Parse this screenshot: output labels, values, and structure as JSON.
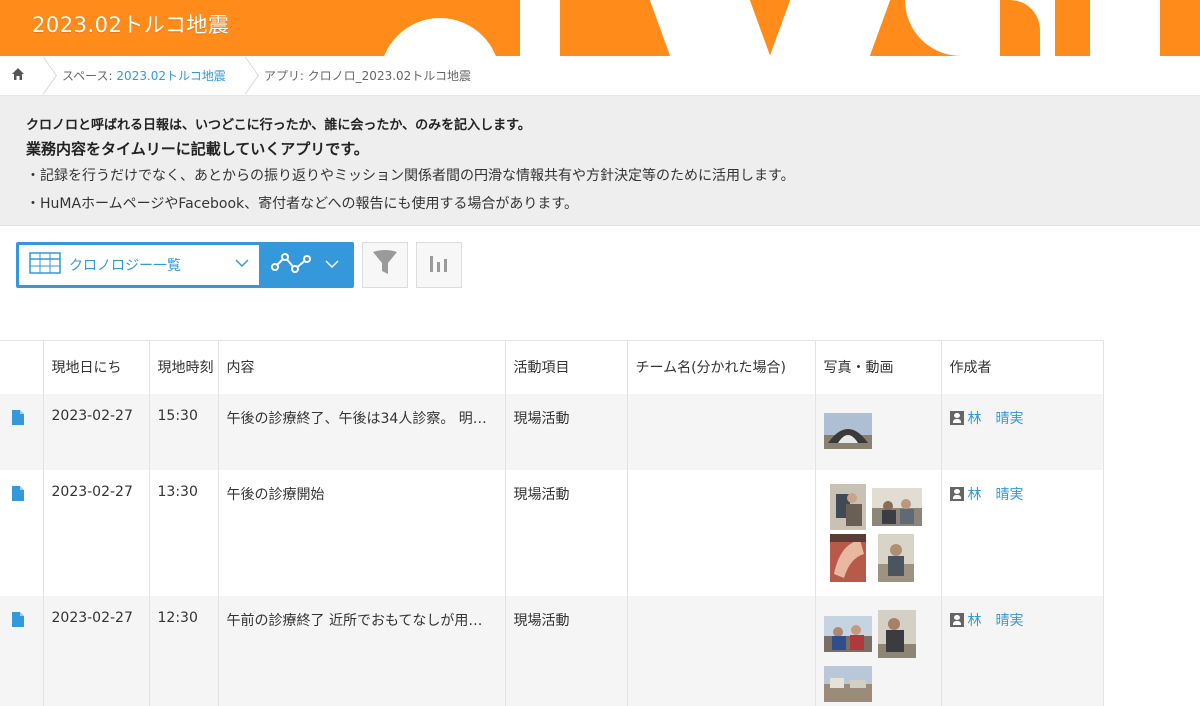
{
  "space_title": "2023.02トルコ地震",
  "colors": {
    "brand_orange": "#ff8c1a",
    "accent_blue": "#3498db"
  },
  "breadcrumb": {
    "home_icon": "home-icon",
    "space_prefix": "スペース: ",
    "space_name": "2023.02トルコ地震",
    "app": "アプリ: クロノロ_2023.02トルコ地震"
  },
  "description": {
    "line1": "クロノロと呼ばれる日報は、いつどこに行ったか、誰に会ったか、のみを記入します。",
    "line2": "業務内容をタイムリーに記載していくアプリです。",
    "line3": "・記録を行うだけでなく、あとからの振り返りやミッション関係者間の円滑な情報共有や方針決定等のために活用します。",
    "line4": "・HuMAホームページやFacebook、寄付者などへの報告にも使用する場合があります。"
  },
  "toolbar": {
    "view_name": "クロノロジー一覧",
    "view_icon": "table-view-icon",
    "graph_icon": "graph-icon",
    "filter_icon": "filter-icon",
    "chart_icon": "bar-chart-icon"
  },
  "table": {
    "headers": [
      "現地日にち",
      "現地時刻",
      "内容",
      "活動項目",
      "チーム名(分かれた場合)",
      "写真・動画",
      "作成者"
    ],
    "rows": [
      {
        "date": "2023-02-27",
        "time": "15:30",
        "content": "午後の診療終了、午後は34人診察。 明…",
        "activity": "現場活動",
        "team": "",
        "author": "林　晴実",
        "photos": 1
      },
      {
        "date": "2023-02-27",
        "time": "13:30",
        "content": "午後の診療開始",
        "activity": "現場活動",
        "team": "",
        "author": "林　晴実",
        "photos": 4
      },
      {
        "date": "2023-02-27",
        "time": "12:30",
        "content": "午前の診療終了 近所でおもてなしが用…",
        "activity": "現場活動",
        "team": "",
        "author": "林　晴実",
        "photos": 3
      }
    ]
  }
}
